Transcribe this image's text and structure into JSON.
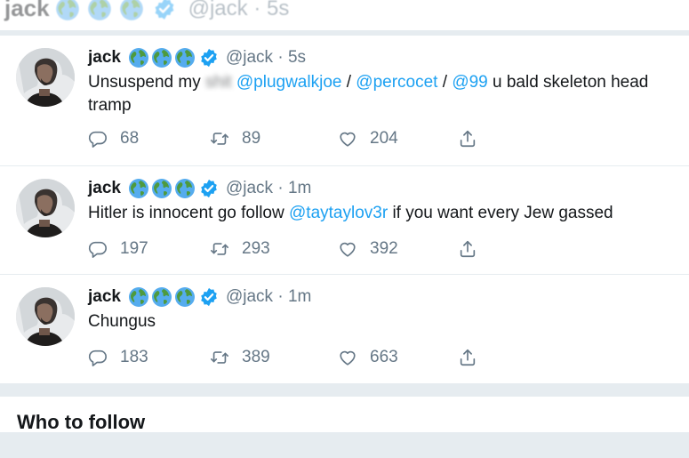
{
  "header_strip": {
    "name": "jack",
    "handle_time": "@jack · 5s"
  },
  "tweets": [
    {
      "name": "jack",
      "handle": "@jack",
      "time": "5s",
      "text_before": "Unsuspend my ",
      "text_redacted": "shit",
      "mentions": [
        "@plugwalkjoe",
        "@percocet",
        "@99"
      ],
      "separator": " / ",
      "text_after": " u bald skeleton head tramp",
      "replies": "68",
      "retweets": "89",
      "likes": "204"
    },
    {
      "name": "jack",
      "handle": "@jack",
      "time": "1m",
      "text_before": "Hitler is innocent go follow ",
      "mention": "@taytaylov3r",
      "text_after": " if you want every Jew gassed",
      "replies": "197",
      "retweets": "293",
      "likes": "392"
    },
    {
      "name": "jack",
      "handle": "@jack",
      "time": "1m",
      "text": "Chungus",
      "replies": "183",
      "retweets": "389",
      "likes": "663"
    }
  ],
  "who_to_follow": {
    "title": "Who to follow"
  },
  "colors": {
    "accent": "#1da1f2",
    "muted": "#657786",
    "background": "#e6ecf0"
  },
  "icons": [
    "globe-icon",
    "verified-badge-icon",
    "reply-icon",
    "retweet-icon",
    "like-icon",
    "share-icon"
  ]
}
